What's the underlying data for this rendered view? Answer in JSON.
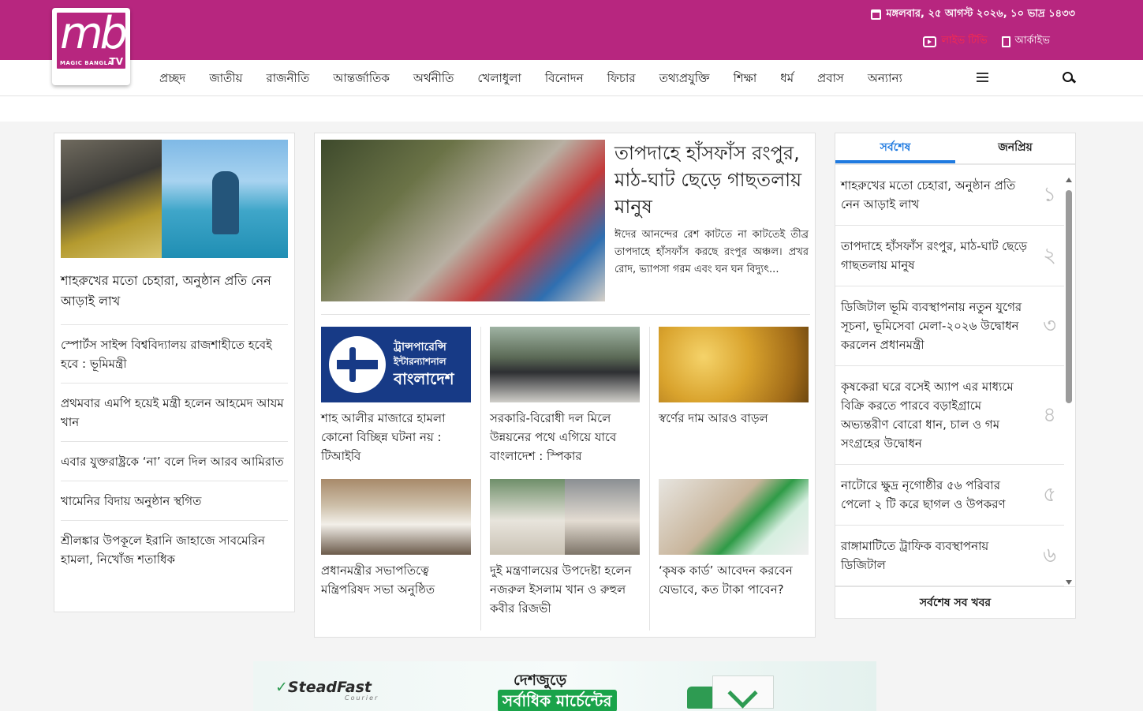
{
  "topbar": {
    "date": "মঙ্গলবার, ২৫ আগস্ট ২০২৬, ১০ ভাদ্র ১৪৩৩",
    "live_tv": "লাইভ টিভি",
    "archive": "আর্কাইভ",
    "colors": {
      "brand": "#b7267f",
      "live": "#ff2b47"
    }
  },
  "logo": {
    "text": "mb",
    "subtitle": "MAGIC BANGLA",
    "tv": "TV"
  },
  "nav": {
    "items": [
      "প্রচ্ছদ",
      "জাতীয়",
      "রাজনীতি",
      "আন্তর্জাতিক",
      "অর্থনীতি",
      "খেলাধুলা",
      "বিনোদন",
      "ফিচার",
      "তথ্যপ্রযুক্তি",
      "শিক্ষা",
      "ধর্ম",
      "প্রবাস",
      "অন্যান্য"
    ]
  },
  "left": {
    "hero_title": "শাহরুখের মতো চেহারা, অনুষ্ঠান প্রতি নেন আড়াই লাখ",
    "list": [
      "স্পোর্টস সাইন্স বিশ্ববিদ্যালয় রাজশাহীতে হবেই হবে : ভূমিমন্ত্রী",
      "প্রথমবার এমপি হয়েই মন্ত্রী হলেন আহমেদ আযম খান",
      "এবার যুক্তরাষ্ট্রকে ‘না’ বলে দিল আরব আমিরাত",
      "খামেনির বিদায় অনুষ্ঠান স্থগিত",
      "শ্রীলঙ্কার উপকূলে ইরানি জাহাজে সাবমেরিন হামলা, নিখোঁজ শতাধিক"
    ]
  },
  "center": {
    "lead_title": "তাপদাহে হাঁসফাঁস রংপুর, মাঠ-ঘাট ছেড়ে গাছতলায় মানুষ",
    "lead_summary": "ঈদের আনন্দের রেশ কাটতে না কাটতেই তীব্র তাপদাহে হাঁসফাঁস করছে রংপুর অঞ্চল। প্রখর রোদ, ভ্যাপসা গরম এবং ঘন ঘন বিদ্যুৎ...",
    "ti_logo": {
      "line1": "ট্রান্সপারেন্সি",
      "line2": "ইন্টারন্যাশনাল",
      "line3": "বাংলাদেশ"
    },
    "cards": [
      {
        "title": "শাহ আলীর মাজারে হামলা কোনো বিচ্ছিন্ন ঘটনা নয় : টিআইবি"
      },
      {
        "title": "সরকারি-বিরোধী দল মিলে উন্নয়নের পথে এগিয়ে যাবে বাংলাদেশ : স্পিকার"
      },
      {
        "title": "স্বর্ণের দাম আরও বাড়ল"
      },
      {
        "title": "প্রধানমন্ত্রীর সভাপতিত্বে মন্ত্রিপরিষদ সভা অনুষ্ঠিত"
      },
      {
        "title": "দুই মন্ত্রণালয়ের উপদেষ্টা হলেন নজরুল ইসলাম খান ও রুহুল কবীর রিজভী"
      },
      {
        "title": "‘কৃষক কার্ড’ আবেদন করবেন যেভাবে, কত টাকা পাবেন?"
      }
    ]
  },
  "right": {
    "tab_latest": "সর্বশেষ",
    "tab_popular": "জনপ্রিয়",
    "latest": [
      {
        "num": "১",
        "title": "শাহরুখের মতো চেহারা, অনুষ্ঠান প্রতি নেন আড়াই লাখ"
      },
      {
        "num": "২",
        "title": "তাপদাহে হাঁসফাঁস রংপুর, মাঠ-ঘাট ছেড়ে গাছতলায় মানুষ"
      },
      {
        "num": "৩",
        "title": "ডিজিটাল ভূমি ব্যবস্থাপনায় নতুন যুগের সূচনা, ভূমিসেবা মেলা-২০২৬ উদ্বোধন করলেন প্রধানমন্ত্রী"
      },
      {
        "num": "৪",
        "title": "কৃষকেরা ঘরে বসেই অ্যাপ এর মাধ্যমে বিক্রি করতে পারবে বড়াইগ্রামে অভ্যন্তরীণ বোরো ধান, চাল ও গম সংগ্রহের উদ্বোধন"
      },
      {
        "num": "৫",
        "title": "নাটোরে ক্ষুদ্র নৃগোষ্ঠীর ৫৬ পরিবার পেলো ২ টি করে ছাগল ও উপকরণ"
      },
      {
        "num": "৬",
        "title": "রাঙ্গামাটিতে ট্রাফিক ব্যবস্থাপনায় ডিজিটাল"
      }
    ],
    "all_latest": "সর্বশেষ সব খবর",
    "accent": "#1f7ae0"
  },
  "banner": {
    "brand": "SteadFast",
    "brand_sub": "Courier",
    "line1": "দেশজুড়ে",
    "line2": "সর্বাধিক মার্চেন্টের"
  }
}
